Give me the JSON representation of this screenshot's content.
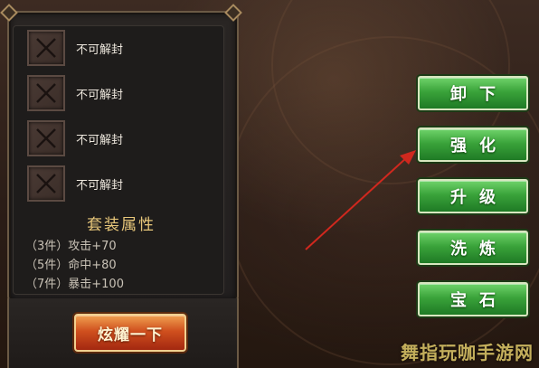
{
  "slots": [
    {
      "label": "不可解封"
    },
    {
      "label": "不可解封"
    },
    {
      "label": "不可解封"
    },
    {
      "label": "不可解封"
    }
  ],
  "set_bonus": {
    "title": "套装属性",
    "lines": [
      "（3件）攻击+70",
      "（5件）命中+80",
      "（7件）暴击+100"
    ]
  },
  "flaunt_button": "炫耀一下",
  "actions": [
    "卸下",
    "强化",
    "升级",
    "洗炼",
    "宝石"
  ],
  "watermark": "舞指玩咖手游网",
  "colors": {
    "action_green": "#3aa33a",
    "flaunt_orange": "#d0501e",
    "arrow_red": "#d0281e",
    "title_gold": "#e8c77a"
  },
  "icons": {
    "slot": "locked-x-icon",
    "arrow": "pointer-arrow"
  }
}
